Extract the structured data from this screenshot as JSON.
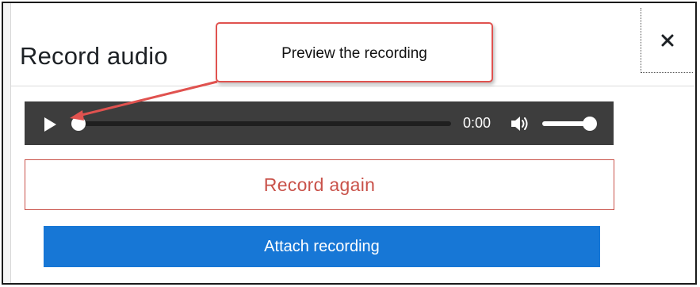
{
  "dialog": {
    "title": "Record audio",
    "close_icon": "close-icon"
  },
  "player": {
    "play_icon": "play-icon",
    "time": "0:00",
    "progress_fraction": 0,
    "volume_icon": "volume-icon",
    "volume_fraction": 1
  },
  "buttons": {
    "record_again": "Record again",
    "attach_recording": "Attach recording"
  },
  "annotation": {
    "callout_text": "Preview the recording"
  },
  "colors": {
    "record_again": "#c9524a",
    "attach": "#1777d6",
    "player_bg": "#3d3d3d",
    "callout_border": "#e0524f"
  }
}
